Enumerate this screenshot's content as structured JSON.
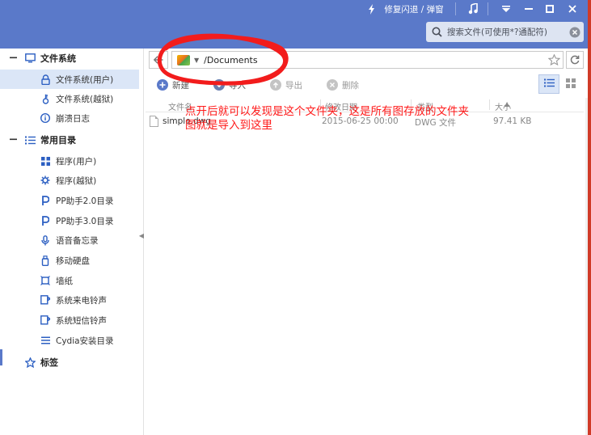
{
  "header": {
    "repair_label": "修复闪退 / 弹窗",
    "search": {
      "placeholder": "搜索文件(可使用*?通配符)",
      "value": ""
    }
  },
  "sidebar": {
    "sections": [
      {
        "label": "文件系统",
        "items": [
          {
            "label": "文件系统(用户)",
            "icon": "lock-icon",
            "active": true
          },
          {
            "label": "文件系统(越狱)",
            "icon": "key-icon"
          },
          {
            "label": "崩溃日志",
            "icon": "info-icon"
          }
        ]
      },
      {
        "label": "常用目录",
        "items": [
          {
            "label": "程序(用户)",
            "icon": "grid-icon"
          },
          {
            "label": "程序(越狱)",
            "icon": "gear-icon"
          },
          {
            "label": "PP助手2.0目录",
            "icon": "pp-icon"
          },
          {
            "label": "PP助手3.0目录",
            "icon": "pp-icon"
          },
          {
            "label": "语音备忘录",
            "icon": "microphone-icon"
          },
          {
            "label": "移动硬盘",
            "icon": "usb-drive-icon"
          },
          {
            "label": "墙纸",
            "icon": "wallpaper-icon"
          },
          {
            "label": "系统来电铃声",
            "icon": "ringtone-icon"
          },
          {
            "label": "系统短信铃声",
            "icon": "sms-tone-icon"
          },
          {
            "label": "Cydia安装目录",
            "icon": "list-icon"
          }
        ]
      }
    ],
    "tags_label": "标签"
  },
  "pathbar": {
    "path": "/Documents"
  },
  "toolbar": {
    "new_label": "新建",
    "import_label": "导入",
    "export_label": "导出",
    "delete_label": "删除"
  },
  "table": {
    "columns": [
      "文件名",
      "修改日期",
      "类型",
      "大小"
    ],
    "rows": [
      {
        "name": "simple.dwg",
        "modified": "2015-06-25 00:00",
        "type": "DWG 文件",
        "size": "97.41 KB"
      }
    ]
  },
  "annotation": {
    "line1": "点开后就可以发现是这个文件夹，这是所有图存放的文件夹",
    "line2": "图就是导入到这里"
  },
  "colors": {
    "header_bg": "#5a79c9",
    "active_item_bg": "#dbe6f7",
    "annotation_red": "#ff1a1a"
  }
}
